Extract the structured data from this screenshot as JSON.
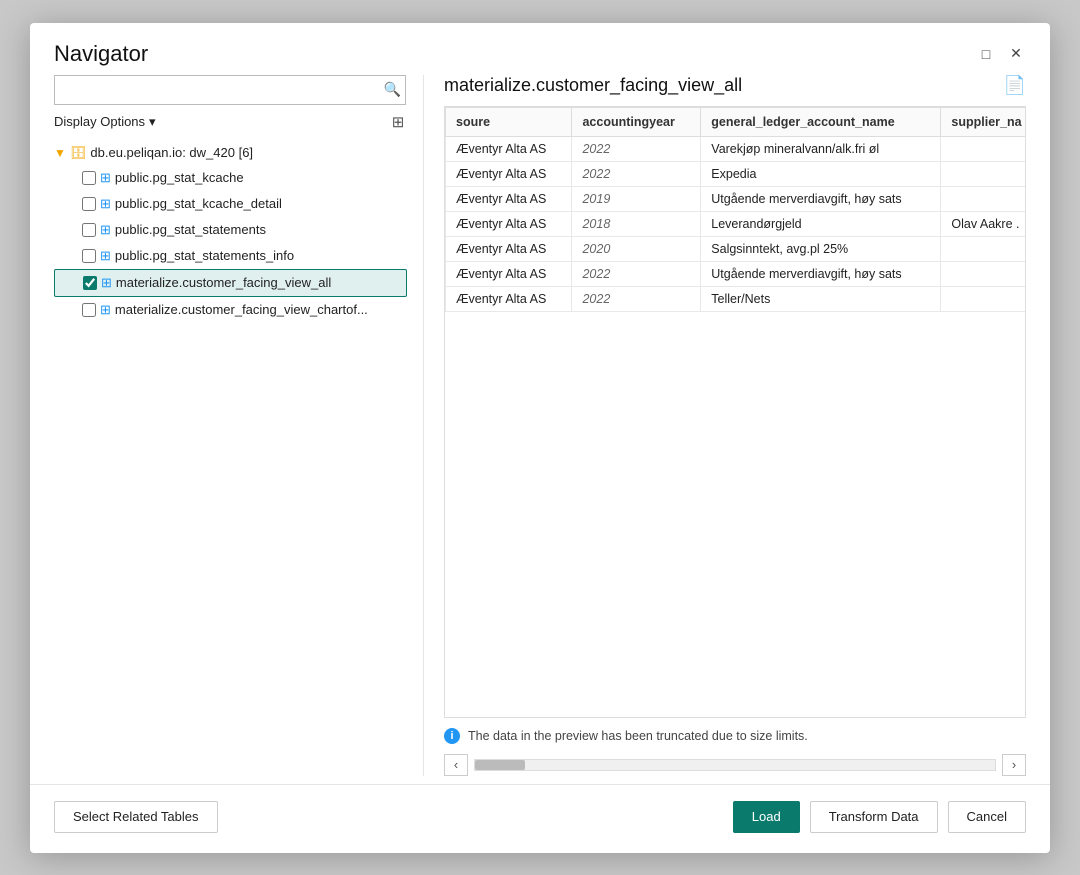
{
  "dialog": {
    "title": "Navigator",
    "close_btn": "✕",
    "maximize_btn": "□"
  },
  "search": {
    "placeholder": "",
    "search_icon": "🔍"
  },
  "display_options": {
    "label": "Display Options",
    "chevron": "▾"
  },
  "tree": {
    "root": {
      "label": "db.eu.peliqan.io: dw_420 [6]",
      "icon": "▶",
      "db_icon": "🗄"
    },
    "items": [
      {
        "label": "public.pg_stat_kcache",
        "checked": false,
        "selected": false
      },
      {
        "label": "public.pg_stat_kcache_detail",
        "checked": false,
        "selected": false
      },
      {
        "label": "public.pg_stat_statements",
        "checked": false,
        "selected": false
      },
      {
        "label": "public.pg_stat_statements_info",
        "checked": false,
        "selected": false
      },
      {
        "label": "materialize.customer_facing_view_all",
        "checked": true,
        "selected": true
      },
      {
        "label": "materialize.customer_facing_view_chartof...",
        "checked": false,
        "selected": false
      }
    ]
  },
  "preview": {
    "title": "materialize.customer_facing_view_all",
    "file_icon": "📄",
    "truncated_msg": "The data in the preview has been truncated due to size limits.",
    "columns": [
      "soure",
      "accountingyear",
      "general_ledger_account_name",
      "supplier_na"
    ],
    "rows": [
      {
        "soure": "Æventyr Alta AS",
        "accountingyear": "2022",
        "general_ledger_account_name": "Varekjøp mineralvann/alk.fri øl",
        "supplier_na": ""
      },
      {
        "soure": "Æventyr Alta AS",
        "accountingyear": "2022",
        "general_ledger_account_name": "Expedia",
        "supplier_na": ""
      },
      {
        "soure": "Æventyr Alta AS",
        "accountingyear": "2019",
        "general_ledger_account_name": "Utgående merverdiavgift, høy sats",
        "supplier_na": ""
      },
      {
        "soure": "Æventyr Alta AS",
        "accountingyear": "2018",
        "general_ledger_account_name": "Leverandørgjeld",
        "supplier_na": "Olav Aakre ."
      },
      {
        "soure": "Æventyr Alta AS",
        "accountingyear": "2020",
        "general_ledger_account_name": "Salgsinntekt, avg.pl 25%",
        "supplier_na": ""
      },
      {
        "soure": "Æventyr Alta AS",
        "accountingyear": "2022",
        "general_ledger_account_name": "Utgående merverdiavgift, høy sats",
        "supplier_na": ""
      },
      {
        "soure": "Æventyr Alta AS",
        "accountingyear": "2022",
        "general_ledger_account_name": "Teller/Nets",
        "supplier_na": ""
      }
    ]
  },
  "footer": {
    "select_related_tables_label": "Select Related Tables",
    "load_label": "Load",
    "transform_data_label": "Transform Data",
    "cancel_label": "Cancel"
  }
}
